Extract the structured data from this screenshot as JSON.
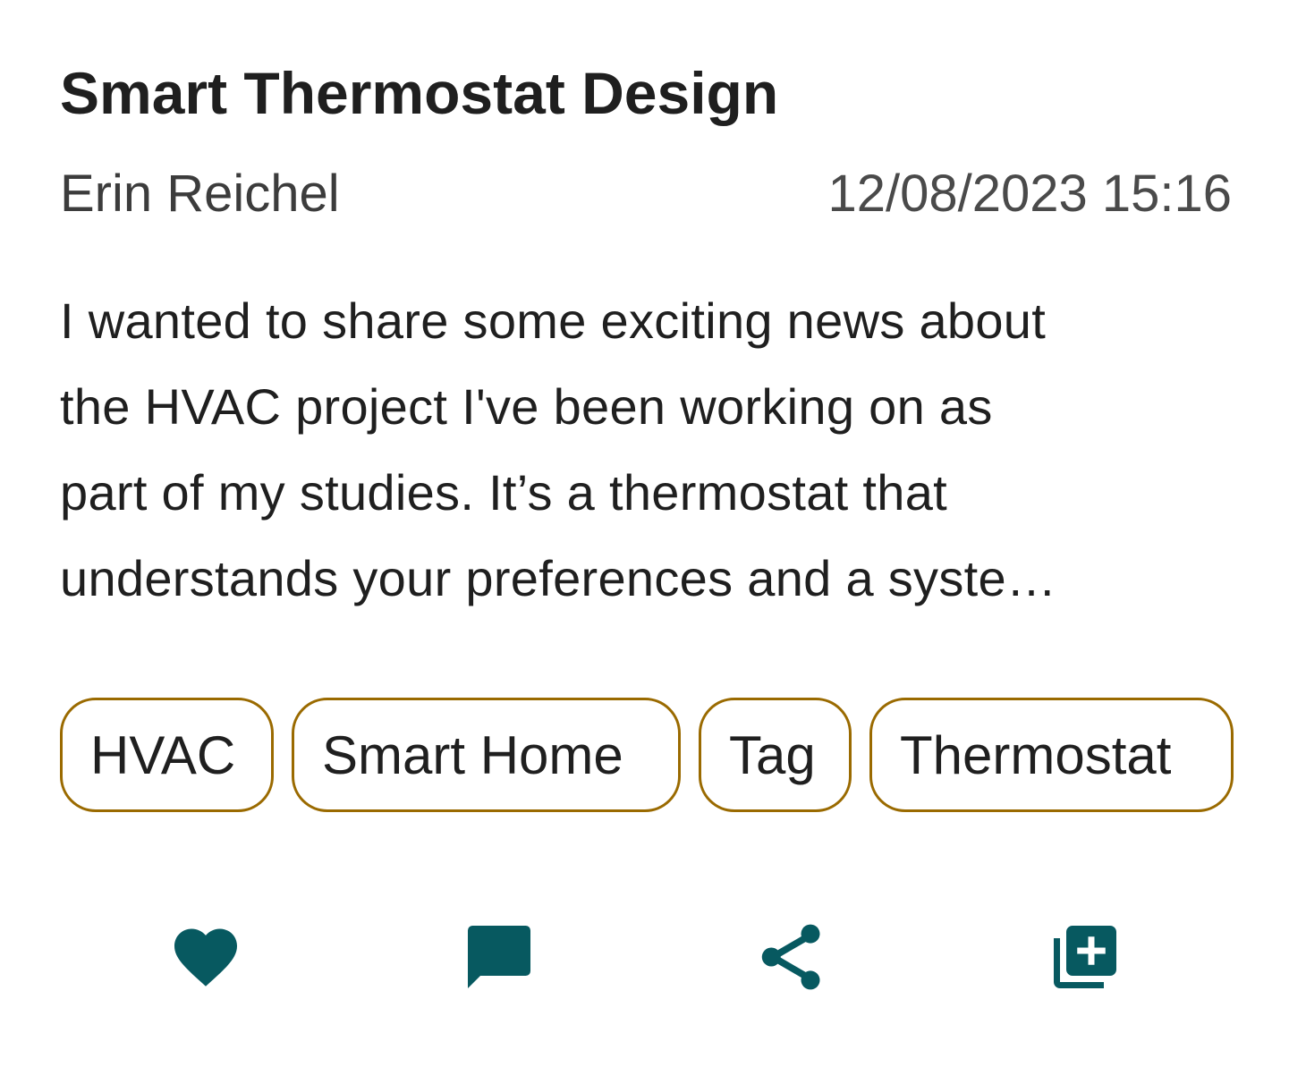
{
  "post": {
    "title": "Smart Thermostat Design",
    "author": "Erin Reichel",
    "timestamp": "12/08/2023 15:16",
    "excerpt_lines": [
      "I wanted to share some exciting news about",
      "the HVAC project I've been working on as",
      "part of my studies. It’s a thermostat that",
      "understands your preferences and a syste…"
    ]
  },
  "tags": [
    "HVAC",
    "Smart Home",
    "Tag",
    "Thermostat"
  ],
  "actions": {
    "like_icon": "heart-icon",
    "comment_icon": "comment-icon",
    "share_icon": "share-icon",
    "save_icon": "add-to-collection-icon"
  },
  "colors": {
    "title": "#1f1f1f",
    "meta": "#3c3c3c",
    "tag_border": "#9a6a00",
    "icon": "#075960"
  }
}
